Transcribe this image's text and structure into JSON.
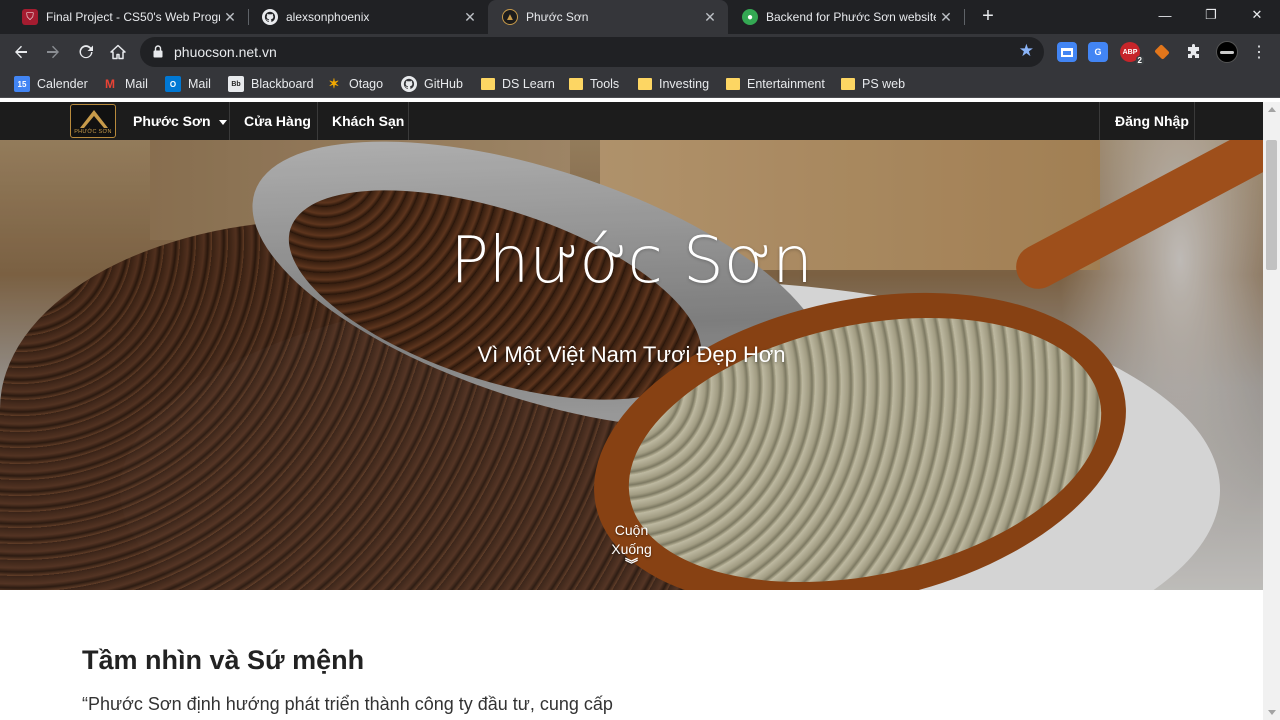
{
  "browser": {
    "tabs": [
      {
        "title": "Final Project - CS50's Web Progra",
        "icon": "harvard-shield-icon",
        "active": false
      },
      {
        "title": "alexsonphoenix",
        "icon": "github-icon",
        "active": false
      },
      {
        "title": "Phước Sơn",
        "icon": "phuoc-son-favicon",
        "active": true
      },
      {
        "title": "Backend for Phước Sơn website",
        "icon": "green-globe-icon",
        "active": false
      }
    ],
    "tab_close": "✕",
    "new_tab": "+",
    "url": "phuocson.net.vn",
    "window_controls": {
      "minimize": "—",
      "restore": "❐",
      "close": "✕"
    },
    "extensions": [
      {
        "name": "tab-manager-extension-icon",
        "label": "",
        "color": "#4285f4"
      },
      {
        "name": "google-translate-icon",
        "label": "G",
        "color": "#4285f4"
      },
      {
        "name": "adblock-icon",
        "label": "ABP",
        "color": "#c7252a",
        "badge": "2"
      },
      {
        "name": "metamask-extension-icon",
        "label": "",
        "color": "#e2761b"
      },
      {
        "name": "puzzle-extensions-icon",
        "label": "",
        "color": "#e8eaed"
      },
      {
        "name": "profile-avatar-icon",
        "label": "",
        "color": "#000000"
      }
    ],
    "bookmarks": [
      {
        "label": "Calender",
        "icon": "google-calendar-icon",
        "color": "#4285f4",
        "glyph": "15"
      },
      {
        "label": "Mail",
        "icon": "gmail-icon",
        "color": "#ea4335",
        "glyph": "M"
      },
      {
        "label": "Mail",
        "icon": "outlook-icon",
        "color": "#0078d4",
        "glyph": "O"
      },
      {
        "label": "Blackboard",
        "icon": "blackboard-icon",
        "color": "#262626",
        "glyph": "Bb"
      },
      {
        "label": "Otago",
        "icon": "otago-icon",
        "color": "#f2a900",
        "glyph": "✶"
      },
      {
        "label": "GitHub",
        "icon": "github-icon",
        "color": "#e8eaed",
        "glyph": ""
      },
      {
        "label": "DS Learn",
        "icon": "folder-icon",
        "color": "#fdd663",
        "glyph": ""
      },
      {
        "label": "Tools",
        "icon": "folder-icon",
        "color": "#fdd663",
        "glyph": ""
      },
      {
        "label": "Investing",
        "icon": "folder-icon",
        "color": "#fdd663",
        "glyph": ""
      },
      {
        "label": "Entertainment",
        "icon": "folder-icon",
        "color": "#fdd663",
        "glyph": ""
      },
      {
        "label": "PS web",
        "icon": "folder-icon",
        "color": "#fdd663",
        "glyph": ""
      }
    ]
  },
  "site": {
    "logo_text": "PHƯỚC SƠN",
    "nav": {
      "brand_menu": "Phước Sơn",
      "store": "Cửa Hàng",
      "hotel": "Khách Sạn",
      "login": "Đăng Nhập"
    },
    "hero": {
      "title": "Phước Sơn",
      "subtitle": "Vì Một Việt Nam Tươi Đẹp Hơn",
      "scroll_line1": "Cuộn",
      "scroll_line2": "Xuống",
      "scroll_chevron": "︾"
    },
    "section": {
      "title": "Tầm nhìn và Sứ mệnh",
      "text": "“Phước Sơn định hướng phát triển thành công ty đầu tư, cung cấp"
    }
  },
  "colors": {
    "chrome_dark": "#202124",
    "chrome_toolbar": "#35363a",
    "site_nav": "#1c1c1c",
    "accent_star": "#8ab4f8"
  }
}
